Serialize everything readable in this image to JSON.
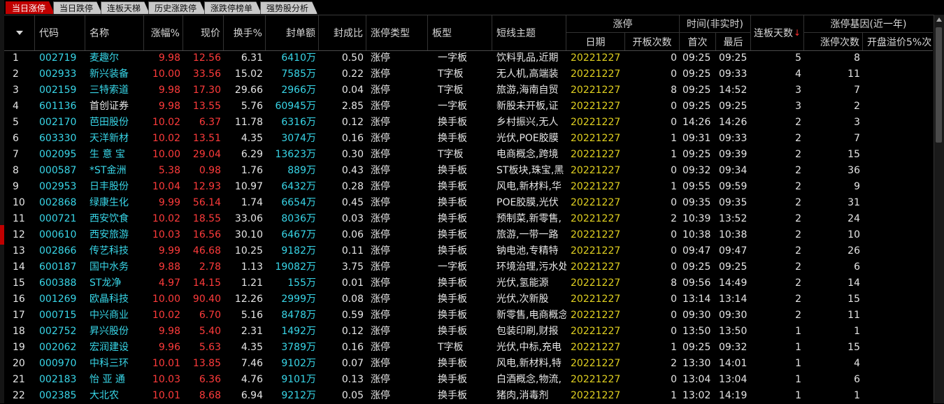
{
  "tabs": [
    {
      "label": "当日涨停",
      "active": true
    },
    {
      "label": "当日跌停",
      "active": false
    },
    {
      "label": "连板天梯",
      "active": false
    },
    {
      "label": "历史涨跌停",
      "active": false
    },
    {
      "label": "涨跌停榜单",
      "active": false
    },
    {
      "label": "强势股分析",
      "active": false
    }
  ],
  "header": {
    "code": "代码",
    "name": "名称",
    "pct": "涨幅%",
    "price": "现价",
    "turnover": "换手%",
    "seal": "封单额",
    "ratio": "封成比",
    "type": "涨停类型",
    "board": "板型",
    "theme": "短线主题",
    "limit_group": "涨停",
    "date": "日期",
    "open_count": "开板次数",
    "time_group": "时间(非实时)",
    "first": "首次",
    "last": "最后",
    "days": "连板天数",
    "days_sort": "↓",
    "gene_group": "涨停基因(近一年)",
    "gene_count": "涨停次数",
    "gene_open": "开盘溢价5%次"
  },
  "rows": [
    {
      "n": "1",
      "code": "002719",
      "name": "麦趣尔",
      "pct": "9.98",
      "price": "12.56",
      "turnover": "6.31",
      "seal": "6410万",
      "ratio": "0.50",
      "type": "涨停",
      "board": "一字板",
      "theme": "饮料乳品,近期",
      "date": "20221227",
      "open": "0",
      "first": "09:25",
      "last": "09:25",
      "days": "5",
      "gene": "8"
    },
    {
      "n": "2",
      "code": "002933",
      "name": "新兴装备",
      "pct": "10.00",
      "price": "33.56",
      "turnover": "15.02",
      "seal": "7585万",
      "ratio": "0.22",
      "type": "涨停",
      "board": "T字板",
      "theme": "无人机,高端装",
      "date": "20221227",
      "open": "0",
      "first": "09:25",
      "last": "09:33",
      "days": "4",
      "gene": "11"
    },
    {
      "n": "3",
      "code": "002159",
      "name": "三特索道",
      "pct": "9.98",
      "price": "17.30",
      "turnover": "29.66",
      "seal": "2966万",
      "ratio": "0.04",
      "type": "涨停",
      "board": "T字板",
      "theme": "旅游,海南自贸",
      "date": "20221227",
      "open": "8",
      "first": "09:25",
      "last": "14:52",
      "days": "3",
      "gene": "7"
    },
    {
      "n": "4",
      "code": "601136",
      "name": "首创证券",
      "pct": "9.98",
      "price": "13.55",
      "turnover": "5.76",
      "seal": "60945万",
      "ratio": "2.85",
      "type": "涨停",
      "board": "一字板",
      "theme": "新股未开板,证",
      "date": "20221227",
      "open": "0",
      "first": "09:25",
      "last": "09:25",
      "days": "3",
      "gene": "2"
    },
    {
      "n": "5",
      "code": "002170",
      "name": "芭田股份",
      "pct": "10.02",
      "price": "6.37",
      "turnover": "11.78",
      "seal": "6316万",
      "ratio": "0.12",
      "type": "涨停",
      "board": "换手板",
      "theme": "乡村振兴,无人",
      "date": "20221227",
      "open": "0",
      "first": "14:26",
      "last": "14:26",
      "days": "2",
      "gene": "3"
    },
    {
      "n": "6",
      "code": "603330",
      "name": "天洋新材",
      "pct": "10.02",
      "price": "13.51",
      "turnover": "4.35",
      "seal": "3074万",
      "ratio": "0.16",
      "type": "涨停",
      "board": "换手板",
      "theme": "光伏,POE胶膜",
      "date": "20221227",
      "open": "1",
      "first": "09:31",
      "last": "09:33",
      "days": "2",
      "gene": "7"
    },
    {
      "n": "7",
      "code": "002095",
      "name": "生 意 宝",
      "pct": "10.00",
      "price": "29.04",
      "turnover": "6.29",
      "seal": "13623万",
      "ratio": "0.30",
      "type": "涨停",
      "board": "T字板",
      "theme": "电商概念,跨境",
      "date": "20221227",
      "open": "1",
      "first": "09:25",
      "last": "09:39",
      "days": "2",
      "gene": "15"
    },
    {
      "n": "8",
      "code": "000587",
      "name": "*ST金洲",
      "pct": "5.38",
      "price": "0.98",
      "turnover": "1.76",
      "seal": "889万",
      "ratio": "0.43",
      "type": "涨停",
      "board": "换手板",
      "theme": "ST板块,珠宝,黑",
      "date": "20221227",
      "open": "0",
      "first": "09:32",
      "last": "09:34",
      "days": "2",
      "gene": "36"
    },
    {
      "n": "9",
      "code": "002953",
      "name": "日丰股份",
      "pct": "10.04",
      "price": "12.93",
      "turnover": "10.97",
      "seal": "6432万",
      "ratio": "0.28",
      "type": "涨停",
      "board": "换手板",
      "theme": "风电,新材料,华",
      "date": "20221227",
      "open": "1",
      "first": "09:55",
      "last": "09:59",
      "days": "2",
      "gene": "9"
    },
    {
      "n": "10",
      "code": "002868",
      "name": "绿康生化",
      "pct": "9.99",
      "price": "56.14",
      "turnover": "1.74",
      "seal": "6654万",
      "ratio": "0.45",
      "type": "涨停",
      "board": "换手板",
      "theme": "POE胶膜,光伏",
      "date": "20221227",
      "open": "0",
      "first": "09:35",
      "last": "09:35",
      "days": "2",
      "gene": "31"
    },
    {
      "n": "11",
      "code": "000721",
      "name": "西安饮食",
      "pct": "10.02",
      "price": "18.55",
      "turnover": "33.06",
      "seal": "8036万",
      "ratio": "0.03",
      "type": "涨停",
      "board": "换手板",
      "theme": "预制菜,新零售,",
      "date": "20221227",
      "open": "2",
      "first": "10:39",
      "last": "13:52",
      "days": "2",
      "gene": "24"
    },
    {
      "n": "12",
      "code": "000610",
      "name": "西安旅游",
      "pct": "10.03",
      "price": "16.56",
      "turnover": "30.10",
      "seal": "6467万",
      "ratio": "0.06",
      "type": "涨停",
      "board": "换手板",
      "theme": "旅游,一带一路",
      "date": "20221227",
      "open": "0",
      "first": "10:38",
      "last": "10:38",
      "days": "2",
      "gene": "10"
    },
    {
      "n": "13",
      "code": "002866",
      "name": "传艺科技",
      "pct": "9.99",
      "price": "46.68",
      "turnover": "10.25",
      "seal": "9182万",
      "ratio": "0.11",
      "type": "涨停",
      "board": "换手板",
      "theme": "钠电池,专精特",
      "date": "20221227",
      "open": "0",
      "first": "09:47",
      "last": "09:47",
      "days": "2",
      "gene": "26"
    },
    {
      "n": "14",
      "code": "600187",
      "name": "国中水务",
      "pct": "9.88",
      "price": "2.78",
      "turnover": "1.13",
      "seal": "19082万",
      "ratio": "3.75",
      "type": "涨停",
      "board": "一字板",
      "theme": "环境治理,污水处",
      "date": "20221227",
      "open": "0",
      "first": "09:25",
      "last": "09:25",
      "days": "2",
      "gene": "6"
    },
    {
      "n": "15",
      "code": "600388",
      "name": "ST龙净",
      "pct": "4.97",
      "price": "14.15",
      "turnover": "1.21",
      "seal": "155万",
      "ratio": "0.01",
      "type": "涨停",
      "board": "换手板",
      "theme": "光伏,氢能源",
      "date": "20221227",
      "open": "8",
      "first": "09:56",
      "last": "14:49",
      "days": "2",
      "gene": "14"
    },
    {
      "n": "16",
      "code": "001269",
      "name": "欧晶科技",
      "pct": "10.00",
      "price": "90.40",
      "turnover": "12.26",
      "seal": "2999万",
      "ratio": "0.08",
      "type": "涨停",
      "board": "换手板",
      "theme": "光伏,次新股",
      "date": "20221227",
      "open": "0",
      "first": "13:14",
      "last": "13:14",
      "days": "2",
      "gene": "15"
    },
    {
      "n": "17",
      "code": "000715",
      "name": "中兴商业",
      "pct": "10.02",
      "price": "6.70",
      "turnover": "5.16",
      "seal": "8478万",
      "ratio": "0.59",
      "type": "涨停",
      "board": "换手板",
      "theme": "新零售,电商概念",
      "date": "20221227",
      "open": "0",
      "first": "09:30",
      "last": "09:30",
      "days": "2",
      "gene": "11"
    },
    {
      "n": "18",
      "code": "002752",
      "name": "昇兴股份",
      "pct": "9.98",
      "price": "5.40",
      "turnover": "2.31",
      "seal": "1492万",
      "ratio": "0.12",
      "type": "涨停",
      "board": "换手板",
      "theme": "包装印刷,财报",
      "date": "20221227",
      "open": "0",
      "first": "13:50",
      "last": "13:50",
      "days": "1",
      "gene": "1"
    },
    {
      "n": "19",
      "code": "002062",
      "name": "宏润建设",
      "pct": "9.96",
      "price": "5.63",
      "turnover": "4.35",
      "seal": "3789万",
      "ratio": "0.16",
      "type": "涨停",
      "board": "T字板",
      "theme": "光伏,中标,充电",
      "date": "20221227",
      "open": "1",
      "first": "09:25",
      "last": "09:32",
      "days": "1",
      "gene": "15"
    },
    {
      "n": "20",
      "code": "000970",
      "name": "中科三环",
      "pct": "10.01",
      "price": "13.85",
      "turnover": "7.46",
      "seal": "9102万",
      "ratio": "0.07",
      "type": "涨停",
      "board": "换手板",
      "theme": "风电,新材料,特",
      "date": "20221227",
      "open": "2",
      "first": "13:30",
      "last": "14:01",
      "days": "1",
      "gene": "4"
    },
    {
      "n": "21",
      "code": "002183",
      "name": "怡 亚 通",
      "pct": "10.03",
      "price": "6.36",
      "turnover": "4.76",
      "seal": "9101万",
      "ratio": "0.13",
      "type": "涨停",
      "board": "换手板",
      "theme": "白酒概念,物流,",
      "date": "20221227",
      "open": "0",
      "first": "13:04",
      "last": "13:04",
      "days": "1",
      "gene": "6"
    },
    {
      "n": "22",
      "code": "002385",
      "name": "大北农",
      "pct": "10.01",
      "price": "8.68",
      "turnover": "6.94",
      "seal": "9212万",
      "ratio": "0.05",
      "type": "涨停",
      "board": "换手板",
      "theme": "猪肉,消毒剂",
      "date": "20221227",
      "open": "1",
      "first": "13:02",
      "last": "14:19",
      "days": "1",
      "gene": "1"
    }
  ]
}
